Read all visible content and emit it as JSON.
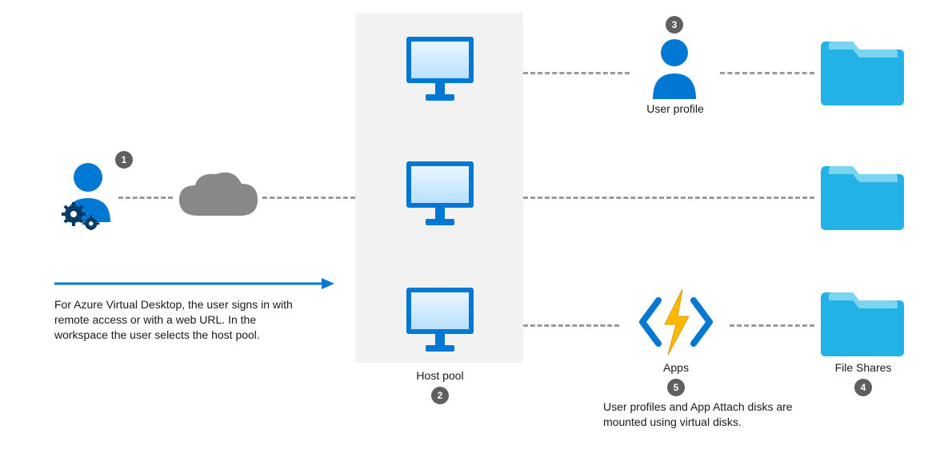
{
  "diagram": {
    "step1": {
      "num": "1",
      "desc": "For Azure Virtual Desktop, the user signs in with remote access or with a web URL. In the workspace the user selects the host pool."
    },
    "step2": {
      "num": "2",
      "label": "Host pool"
    },
    "step3": {
      "num": "3",
      "label": "User profile"
    },
    "step4": {
      "num": "4",
      "label": "File Shares"
    },
    "step5": {
      "num": "5",
      "label": "Apps",
      "desc": "User profiles and App Attach disks are mounted using virtual disks."
    },
    "icons": {
      "user_gear": "user-gear-icon",
      "cloud": "cloud-icon",
      "monitor": "monitor-icon",
      "user": "user-icon",
      "apps": "azure-function-icon",
      "folder": "folder-icon"
    },
    "colors": {
      "azure_blue": "#0078d4",
      "light_blue": "#23b2e8",
      "orange": "#ffb900",
      "gray": "#888888"
    }
  }
}
